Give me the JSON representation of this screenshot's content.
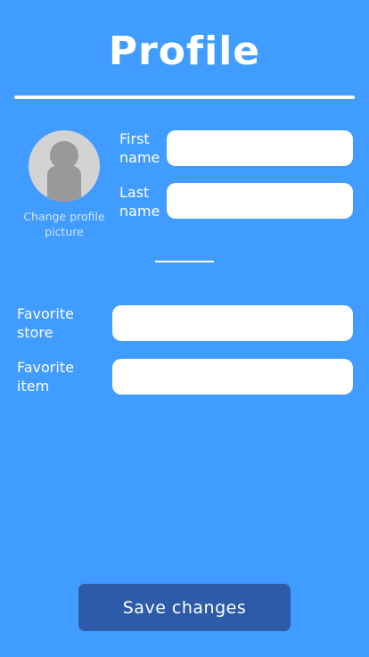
{
  "header": {
    "title": "Profile"
  },
  "avatar": {
    "icon": "person-silhouette-icon",
    "change_label": "Change profile picture"
  },
  "name_fields": {
    "first_name": {
      "label": "First name",
      "value": "",
      "placeholder": ""
    },
    "last_name": {
      "label": "Last name",
      "value": "",
      "placeholder": ""
    }
  },
  "favorites": {
    "store": {
      "label": "Favorite store",
      "value": "",
      "placeholder": ""
    },
    "item": {
      "label": "Favorite item",
      "value": "",
      "placeholder": ""
    }
  },
  "actions": {
    "save_label": "Save changes"
  },
  "colors": {
    "background": "#409cff",
    "button": "#2d5ba8",
    "field": "#ffffff",
    "avatar_bg": "#d3d3d3",
    "avatar_figure": "#999999"
  }
}
